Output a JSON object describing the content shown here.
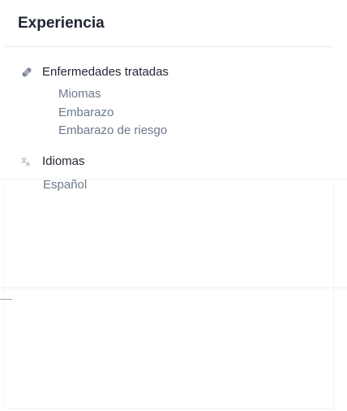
{
  "card": {
    "title": "Experiencia"
  },
  "diseases": {
    "icon": "bandage-icon",
    "label": "Enfermedades tratadas",
    "items": [
      "Miomas",
      "Embarazo",
      "Embarazo de riesgo"
    ]
  },
  "languages": {
    "icon": "translate-icon",
    "label": "Idiomas",
    "items": [
      "Español"
    ]
  },
  "colors": {
    "title": "#1e2532",
    "muted_text": "#6b7a8c",
    "icon": "#7b8794",
    "divider": "#e8ebef"
  }
}
